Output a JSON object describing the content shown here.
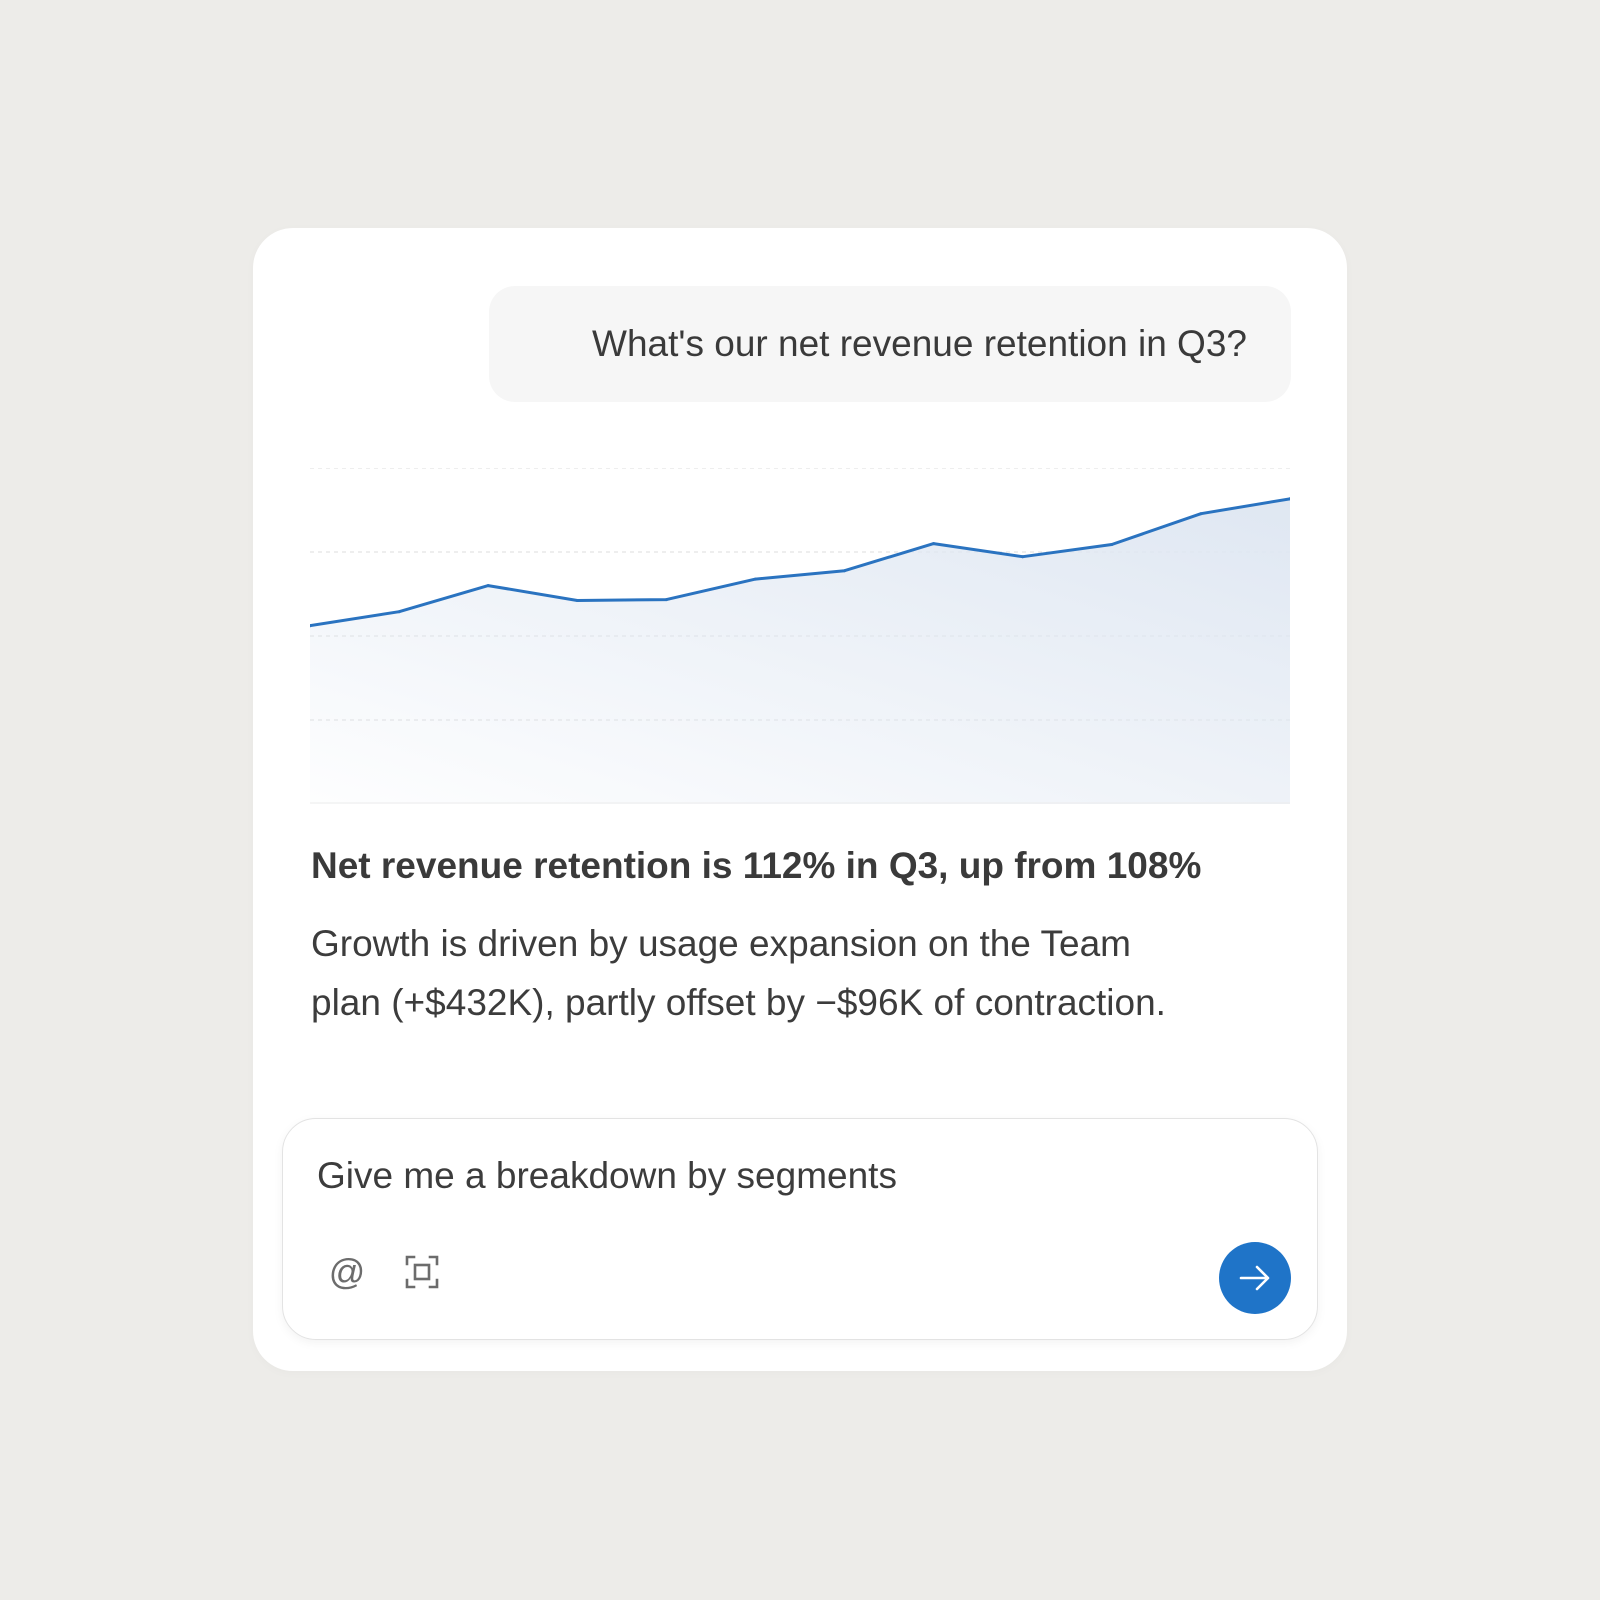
{
  "conversation": {
    "user_message": "What's our net revenue retention in Q3?",
    "answer": {
      "title": "Net revenue retention is 112% in Q3, up from 108%",
      "body_lines": [
        "Growth is driven by usage expansion on the Team",
        "plan (+$432K), partly offset by −$96K of contraction."
      ]
    }
  },
  "composer": {
    "input_value": "Give me a breakdown by segments",
    "mention_label": "@"
  },
  "colors": {
    "background": "#edece9",
    "accent": "#1f74c8",
    "line": "#2a73c0"
  },
  "icons": {
    "mention": "at-sign-icon",
    "capture": "screen-capture-icon",
    "send": "arrow-right-icon"
  },
  "chart_data": {
    "type": "area",
    "title": "",
    "xlabel": "",
    "ylabel": "",
    "x": [
      1,
      2,
      3,
      4,
      5,
      6,
      7,
      8,
      9,
      10,
      11,
      12
    ],
    "series": [
      {
        "values": [
          15.5,
          23,
          37,
          29,
          29.5,
          40.5,
          45,
          59.5,
          52.5,
          59,
          75.5,
          83.5
        ]
      }
    ],
    "ylim": [
      -80,
      100
    ],
    "grid": true
  }
}
